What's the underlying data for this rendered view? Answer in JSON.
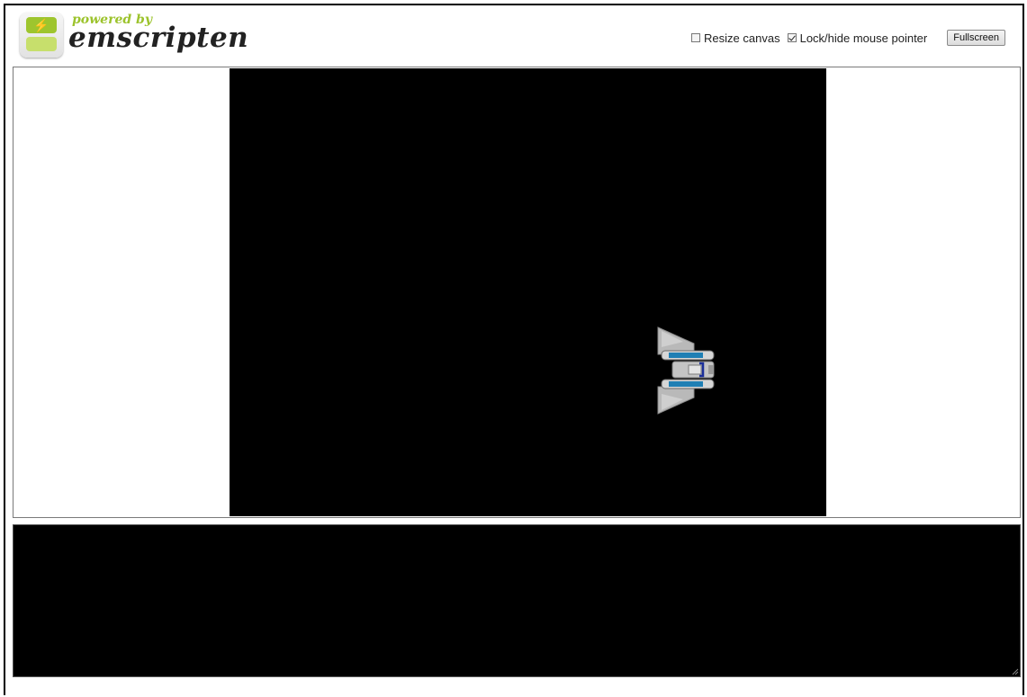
{
  "header": {
    "logo_powered": "powered by",
    "logo_name": "emscripten"
  },
  "controls": {
    "resize_canvas": {
      "label": "Resize canvas",
      "checked": false
    },
    "lock_pointer": {
      "label": "Lock/hide mouse pointer",
      "checked": true
    },
    "fullscreen_label": "Fullscreen"
  },
  "canvas": {
    "background": "#000000",
    "sprite": "spaceship-sprite"
  },
  "output": {
    "text": "",
    "background": "#000000"
  },
  "colors": {
    "logo_green": "#9cc32c",
    "ship_gray": "#b9b9b9",
    "ship_blue": "#1f7fb4"
  }
}
